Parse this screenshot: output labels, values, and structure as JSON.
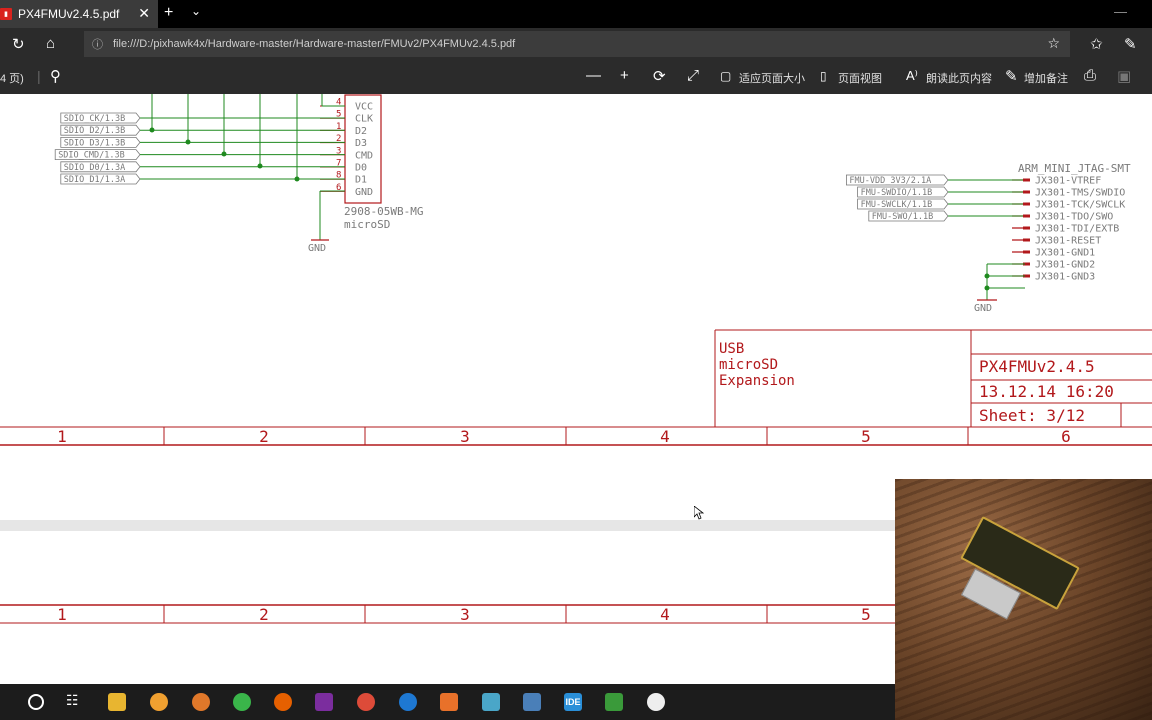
{
  "browser": {
    "tab_title": "PX4FMUv2.4.5.pdf",
    "tab_close": "✕",
    "tab_add": "+",
    "tab_menu": "⌄",
    "minimize": "—",
    "url": "file:///D:/pixhawk4x/Hardware-master/Hardware-master/FMUv2/PX4FMUv2.4.5.pdf",
    "url_info_icon": "ⓘ"
  },
  "pdf_toolbar": {
    "page_count": "4 页)",
    "fit_page": "适应页面大小",
    "page_view": "页面视图",
    "read_aloud": "朗读此页内容",
    "add_notes": "增加备注"
  },
  "schematic": {
    "microsd": {
      "pins": [
        {
          "num": "4",
          "name": "VCC"
        },
        {
          "num": "5",
          "name": "CLK"
        },
        {
          "num": "1",
          "name": "D2"
        },
        {
          "num": "2",
          "name": "D3"
        },
        {
          "num": "3",
          "name": "CMD"
        },
        {
          "num": "7",
          "name": "D0"
        },
        {
          "num": "8",
          "name": "D1"
        },
        {
          "num": "6",
          "name": "GND"
        }
      ],
      "signals": [
        "SDIO_CK/1.3B",
        "SDIO_D2/1.3B",
        "SDIO_D3/1.3B",
        "SDIO_CMD/1.3B",
        "SDIO_D0/1.3A",
        "SDIO_D1/1.3A"
      ],
      "part": "2908-05WB-MG",
      "name": "microSD",
      "gnd": "GND"
    },
    "jtag": {
      "title": "ARM_MINI_JTAG-SMT",
      "pins": [
        "JX301-VTREF",
        "JX301-TMS/SWDIO",
        "JX301-TCK/SWCLK",
        "JX301-TDO/SWO",
        "JX301-TDI/EXTB",
        "JX301-RESET",
        "JX301-GND1",
        "JX301-GND2",
        "JX301-GND3"
      ],
      "signals": [
        "FMU-VDD_3V3/2.1A",
        "FMU-SWDIO/1.1B",
        "FMU-SWCLK/1.1B",
        "FMU-SWO/1.1B"
      ],
      "gnd": "GND"
    },
    "title_block": {
      "desc": [
        "USB",
        "microSD",
        "Expansion"
      ],
      "project": "PX4FMUv2.4.5",
      "date": "13.12.14 16:20",
      "sheet": "Sheet: 3/12"
    },
    "frame_numbers_top": [
      "1",
      "2",
      "3",
      "4",
      "5",
      "6"
    ],
    "frame_numbers_bottom": [
      "1",
      "2",
      "3",
      "4",
      "5"
    ]
  },
  "taskbar": {
    "ide_label": "IDE"
  },
  "colors": {
    "schematic_red": "#b2181b",
    "wire_green": "#1f8a1f",
    "label_gray": "#7a7a7a"
  }
}
